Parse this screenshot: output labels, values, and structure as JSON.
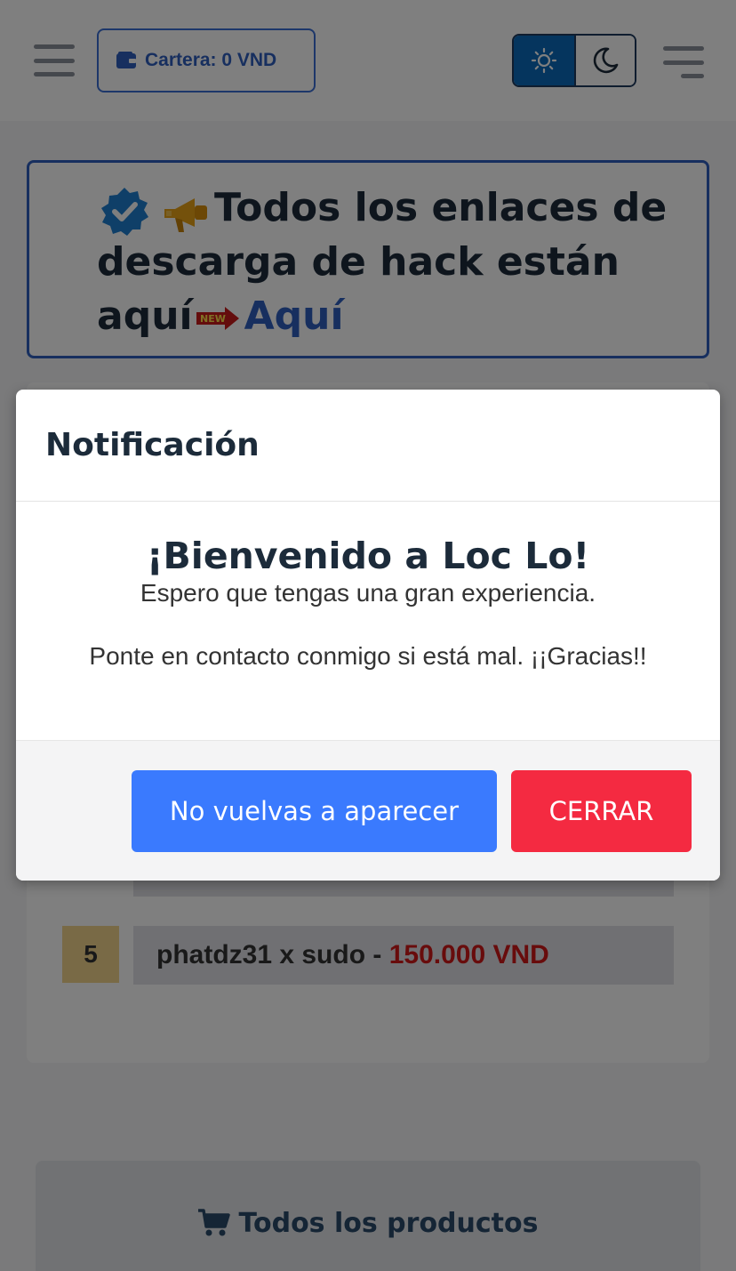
{
  "header": {
    "wallet_label": "Cartera: 0 VND"
  },
  "banner": {
    "text": "Todos los enlaces de descarga de hack están aquí",
    "new_badge": "NEW",
    "link_text": "Aquí"
  },
  "ranking": {
    "row5": {
      "rank": "5",
      "name": "phatdz31 x sudo - ",
      "amount": "150.000 VND"
    }
  },
  "products_button": {
    "label": "Todos los productos"
  },
  "modal": {
    "title": "Notificación",
    "heading": "¡Bienvenido a Loc Lo!",
    "line1": "Espero que tengas una gran experiencia.",
    "line2": "Ponte en contacto conmigo si está mal. ¡¡Gracias!!",
    "dont_show_label": "No vuelvas a aparecer",
    "close_label": "CERRAR"
  },
  "colors": {
    "primary": "#3a7afe",
    "danger": "#f42a41",
    "accent": "#2f5fbf",
    "price": "#d01818"
  }
}
